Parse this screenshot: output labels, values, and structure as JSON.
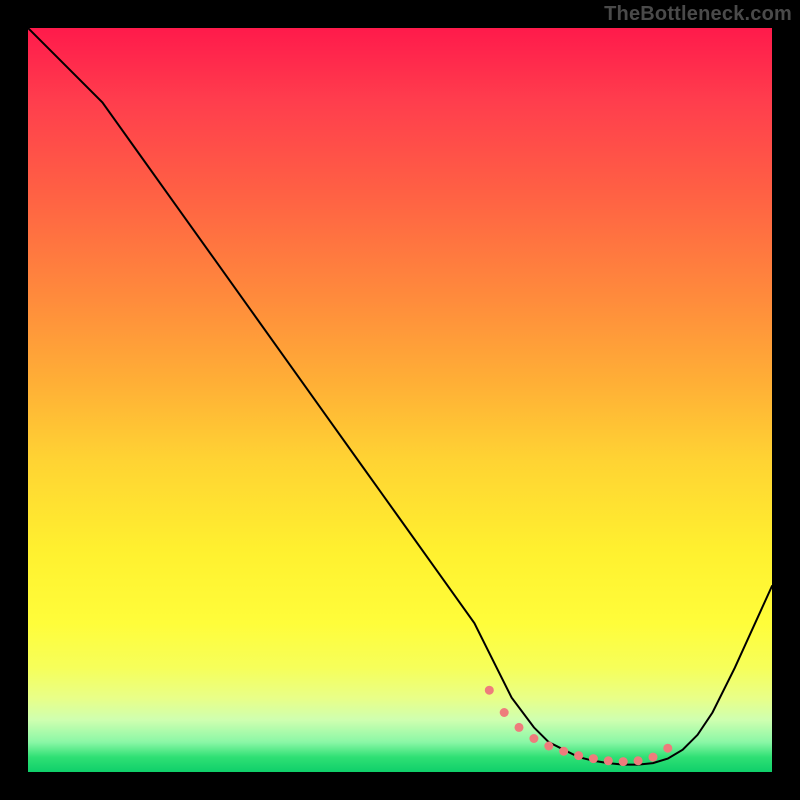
{
  "watermark": "TheBottleneck.com",
  "chart_data": {
    "type": "line",
    "title": "",
    "xlabel": "",
    "ylabel": "",
    "xlim": [
      0,
      100
    ],
    "ylim": [
      0,
      100
    ],
    "series": [
      {
        "name": "bottleneck-curve",
        "x": [
          0,
          5,
          10,
          15,
          20,
          25,
          30,
          35,
          40,
          45,
          50,
          55,
          60,
          63,
          65,
          68,
          70,
          72,
          74,
          76,
          78,
          80,
          82,
          84,
          86,
          88,
          90,
          92,
          95,
          100
        ],
        "y": [
          100,
          95,
          90,
          83,
          76,
          69,
          62,
          55,
          48,
          41,
          34,
          27,
          20,
          14,
          10,
          6,
          4,
          3,
          2,
          1.5,
          1.2,
          1,
          1,
          1.2,
          1.8,
          3,
          5,
          8,
          14,
          25
        ]
      }
    ],
    "dotted_region": {
      "x": [
        62,
        64,
        66,
        68,
        70,
        72,
        74,
        76,
        78,
        80,
        82,
        84,
        86
      ],
      "y": [
        11,
        8,
        6,
        4.5,
        3.5,
        2.8,
        2.2,
        1.8,
        1.5,
        1.4,
        1.5,
        2.0,
        3.2
      ]
    },
    "dot_color": "#ee7c7c",
    "curve_color": "#000000"
  }
}
